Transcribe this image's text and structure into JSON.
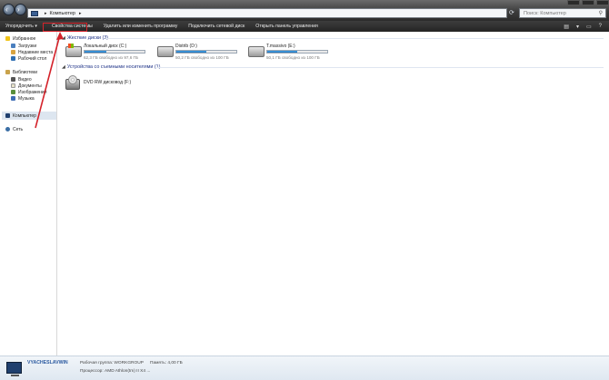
{
  "address": {
    "path": "Компьютер",
    "search_placeholder": "Поиск: Компьютер"
  },
  "toolbar": {
    "organize": "Упорядочить",
    "organize_arrow": "▾",
    "system_properties": "Свойства системы",
    "uninstall": "Удалить или изменить программу",
    "map_drive": "Подключить сетевой диск",
    "control_panel": "Открыть панель управления"
  },
  "sidebar": {
    "favorites": {
      "label": "Избранное",
      "items": [
        {
          "label": "Загрузки"
        },
        {
          "label": "Недавние места"
        },
        {
          "label": "Рабочий стол"
        }
      ]
    },
    "libraries": {
      "label": "Библиотеки",
      "items": [
        {
          "label": "Видео"
        },
        {
          "label": "Документы"
        },
        {
          "label": "Изображения"
        },
        {
          "label": "Музыка"
        }
      ]
    },
    "computer": "Компьютер",
    "network": "Сеть"
  },
  "main": {
    "hard_disks": {
      "header": "Жесткие диски (3)",
      "drives": [
        {
          "name": "Локальный диск (C:)",
          "free": "62,3 ГБ свободно из 97,6 ГБ",
          "used": 0.36
        },
        {
          "name": "Distrib (D:)",
          "free": "50,2 ГБ свободно из 100 ГБ",
          "used": 0.5
        },
        {
          "name": "Т.massivo (E:)",
          "free": "50,1 ГБ свободно из 100 ГБ",
          "used": 0.5
        }
      ]
    },
    "removable": {
      "header": "Устройства со съемными носителями (1)",
      "dvd": {
        "name": "DVD RW дисковод (F:)"
      }
    }
  },
  "status": {
    "computer_name": "VYACHESLAVWIN",
    "workgroup": "Рабочая группа: WORKGROUP",
    "memory": "Память: 4,00 ГБ",
    "processor": "Процессор: AMD Athlon(tm) II X4 ..."
  },
  "colors": {
    "accent": "#d4222a",
    "progress": "#2a86d3",
    "group_header": "#1e3287"
  }
}
